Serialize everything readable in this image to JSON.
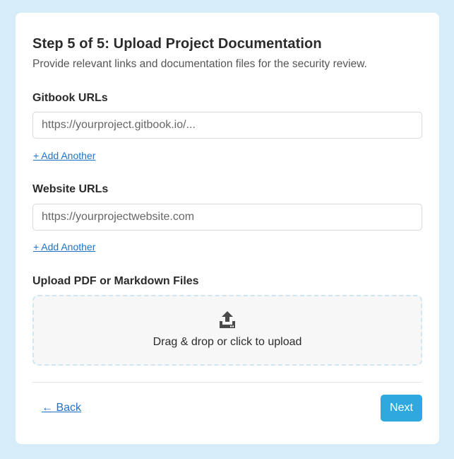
{
  "header": {
    "title": "Step 5 of 5: Upload Project Documentation",
    "subtitle": "Provide relevant links and documentation files for the security review."
  },
  "gitbook": {
    "label": "Gitbook URLs",
    "placeholder": "https://yourproject.gitbook.io/...",
    "value": "",
    "add_label": "+ Add Another"
  },
  "website": {
    "label": "Website URLs",
    "placeholder": "https://yourprojectwebsite.com",
    "value": "",
    "add_label": "+ Add Another"
  },
  "upload": {
    "label": "Upload PDF or Markdown Files",
    "dropzone_text": "Drag & drop or click to upload",
    "icon": "upload-icon"
  },
  "footer": {
    "back_label": "← Back",
    "next_label": "Next"
  },
  "colors": {
    "page_background": "#d6ecf8",
    "accent": "#2fa8e0",
    "link": "#1f73c7",
    "dropzone_border": "#cfe6f4"
  }
}
